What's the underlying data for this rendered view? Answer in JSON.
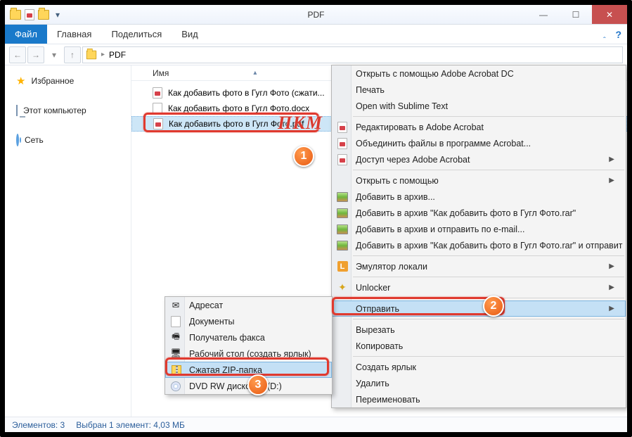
{
  "window": {
    "title": "PDF"
  },
  "ribbon": {
    "file": "Файл",
    "tabs": [
      "Главная",
      "Поделиться",
      "Вид"
    ]
  },
  "breadcrumb": {
    "location": "PDF"
  },
  "sidebar": {
    "favorites": "Избранное",
    "this_pc": "Этот компьютер",
    "network": "Сеть"
  },
  "columns": {
    "name": "Имя"
  },
  "files": [
    {
      "name": "Как добавить фото в Гугл Фото (сжати..."
    },
    {
      "name": "Как добавить фото в Гугл Фото.docx"
    },
    {
      "name": "Как добавить фото в Гугл Фото.pdf"
    }
  ],
  "status": {
    "count": "Элементов: 3",
    "selection": "Выбран 1 элемент: 4,03 МБ"
  },
  "annotation": {
    "pkm": "ПКМ"
  },
  "context_main": {
    "open_adobe": "Открыть с помощью Adobe Acrobat DC",
    "print": "Печать",
    "open_sublime": "Open with Sublime Text",
    "edit_acrobat": "Редактировать в Adobe Acrobat",
    "combine_acrobat": "Объединить файлы в программе Acrobat...",
    "access_acrobat": "Доступ через Adobe Acrobat",
    "open_with": "Открыть с помощью",
    "add_archive": "Добавить в архив...",
    "add_rar": "Добавить в архив \"Как добавить фото в Гугл Фото.rar\"",
    "add_email": "Добавить в архив и отправить по e-mail...",
    "add_rar_email": "Добавить в архив \"Как добавить фото в Гугл Фото.rar\" и отправит",
    "emulator": "Эмулятор локали",
    "unlocker": "Unlocker",
    "send_to": "Отправить",
    "cut": "Вырезать",
    "copy": "Копировать",
    "shortcut": "Создать ярлык",
    "delete": "Удалить",
    "rename": "Переименовать"
  },
  "context_sendto": {
    "recipient": "Адресат",
    "documents": "Документы",
    "fax": "Получатель факса",
    "desktop": "Рабочий стол (создать ярлык)",
    "zip": "Сжатая ZIP-папка",
    "dvd": "DVD RW дисковод (D:)"
  }
}
